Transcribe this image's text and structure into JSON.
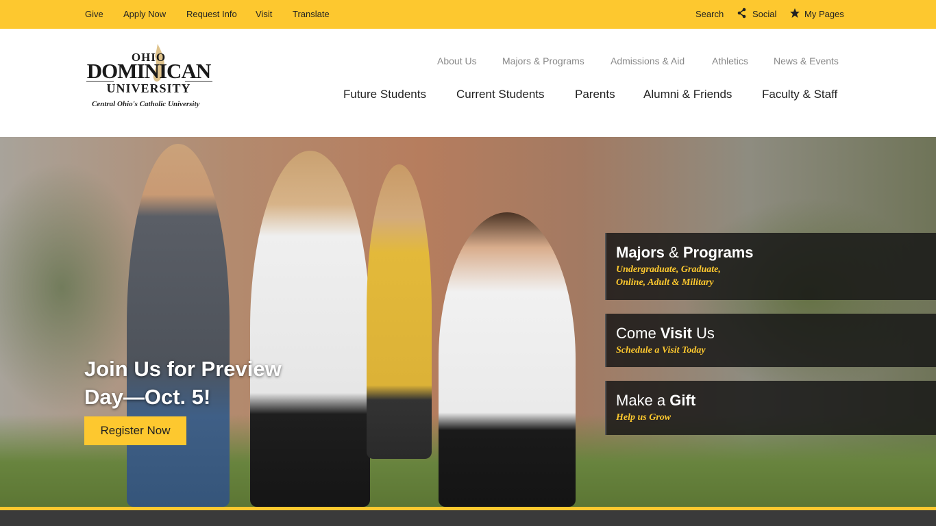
{
  "topbar": {
    "give": "Give",
    "apply": "Apply Now",
    "request": "Request Info",
    "visit": "Visit",
    "translate": "Translate",
    "search": "Search",
    "social": "Social",
    "mypages": "My Pages"
  },
  "logo": {
    "ohio": "OHIO",
    "dominican": "DOMINICAN",
    "university": "UNIVERSITY",
    "tagline": "Central Ohio's Catholic University"
  },
  "secondary_nav": [
    "About Us",
    "Majors & Programs",
    "Admissions & Aid",
    "Athletics",
    "News & Events"
  ],
  "main_nav": [
    "Future Students",
    "Current Students",
    "Parents",
    "Alumni & Friends",
    "Faculty & Staff"
  ],
  "hero": {
    "headline": "Join Us for Preview Day—Oct. 5!",
    "button": "Register Now"
  },
  "cards": [
    {
      "title_pre": "Majors",
      "title_mid": " & ",
      "title_post": "Programs",
      "sub1": "Undergraduate, Graduate,",
      "sub2": "Online, Adult & Military"
    },
    {
      "title_pre": "Come ",
      "title_mid": "Visit",
      "title_post": " Us",
      "sub1": "Schedule a Visit Today"
    },
    {
      "title_pre": "Make a ",
      "title_mid": "Gift",
      "title_post": "",
      "sub1": "Help us Grow"
    }
  ],
  "colors": {
    "accent": "#fdc82f",
    "dark": "#3a3a3a"
  },
  "icons": {
    "social": "share-icon",
    "mypages": "star-icon"
  }
}
